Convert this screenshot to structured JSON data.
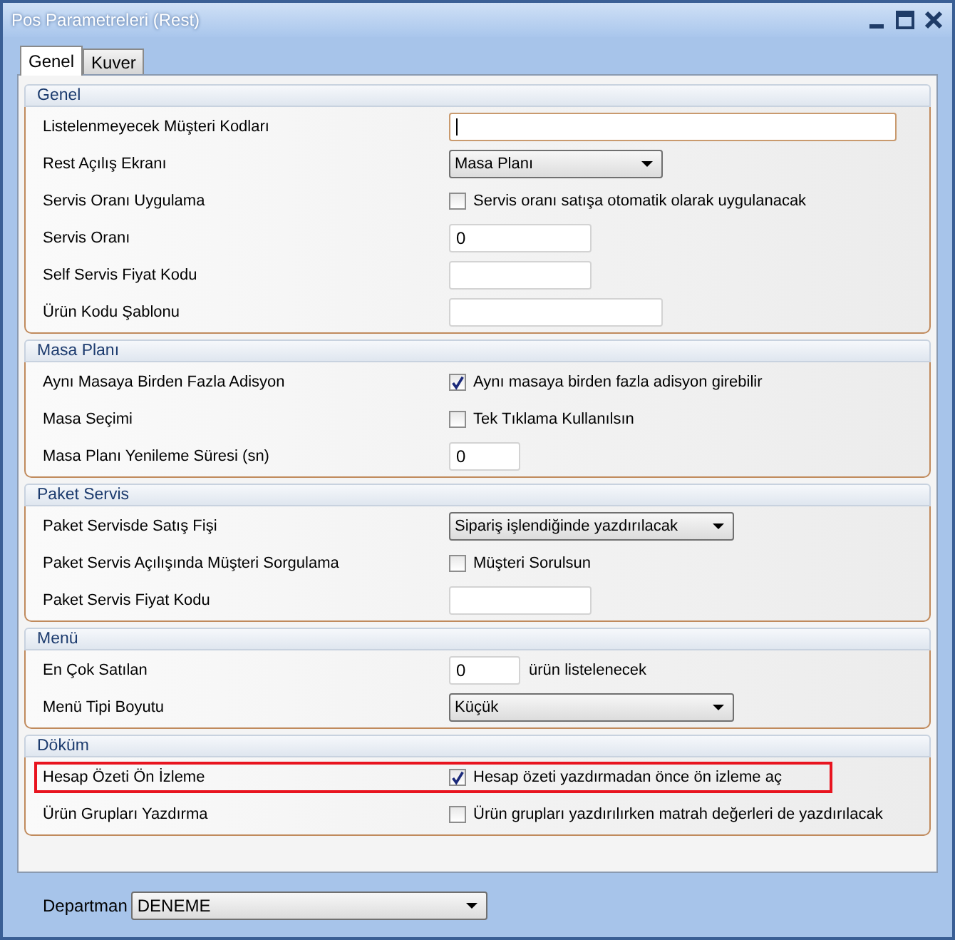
{
  "window": {
    "title": "Pos Parametreleri (Rest)"
  },
  "tabs": [
    {
      "label": "Genel",
      "selected": true
    },
    {
      "label": "Kuver",
      "selected": false
    }
  ],
  "sections": [
    {
      "title": "Genel",
      "rows": [
        {
          "label": "Listelenmeyecek Müşteri Kodları",
          "kind": "text",
          "value": "",
          "focused": true
        },
        {
          "label": "Rest Açılış Ekranı",
          "kind": "dropdown",
          "value": "Masa Planı"
        },
        {
          "label": "Servis Oranı Uygulama",
          "kind": "checkbox",
          "checked": false,
          "text": "Servis oranı satışa otomatik olarak uygulanacak"
        },
        {
          "label": "Servis Oranı",
          "kind": "text",
          "value": "0"
        },
        {
          "label": "Self Servis Fiyat Kodu",
          "kind": "text",
          "value": ""
        },
        {
          "label": "Ürün Kodu Şablonu",
          "kind": "text",
          "value": ""
        }
      ]
    },
    {
      "title": "Masa Planı",
      "rows": [
        {
          "label": "Aynı Masaya Birden Fazla Adisyon",
          "kind": "checkbox",
          "checked": true,
          "text": "Aynı masaya birden fazla adisyon girebilir"
        },
        {
          "label": "Masa Seçimi",
          "kind": "checkbox",
          "checked": false,
          "text": "Tek Tıklama Kullanılsın"
        },
        {
          "label": "Masa Planı Yenileme Süresi (sn)",
          "kind": "text",
          "value": "0"
        }
      ]
    },
    {
      "title": "Paket Servis",
      "rows": [
        {
          "label": "Paket Servisde Satış Fişi",
          "kind": "dropdown",
          "value": "Sipariş işlendiğinde yazdırılacak"
        },
        {
          "label": "Paket Servis Açılışında Müşteri Sorgulama",
          "kind": "checkbox",
          "checked": false,
          "text": "Müşteri Sorulsun"
        },
        {
          "label": "Paket Servis Fiyat Kodu",
          "kind": "text",
          "value": ""
        }
      ]
    },
    {
      "title": "Menü",
      "rows": [
        {
          "label": "En Çok Satılan",
          "kind": "text",
          "value": "0",
          "suffix": "ürün listelenecek"
        },
        {
          "label": "Menü Tipi Boyutu",
          "kind": "dropdown",
          "value": "Küçük"
        }
      ]
    },
    {
      "title": "Döküm",
      "rows": [
        {
          "label": "Hesap Özeti Ön İzleme",
          "kind": "checkbox",
          "checked": true,
          "text": "Hesap özeti yazdırmadan önce ön izleme aç",
          "highlighted": true
        },
        {
          "label": "Ürün Grupları Yazdırma",
          "kind": "checkbox",
          "checked": false,
          "text": "Ürün grupları yazdırılırken matrah değerleri de yazdırılacak"
        }
      ]
    }
  ],
  "department": {
    "label": "Departman",
    "value": "DENEME"
  }
}
